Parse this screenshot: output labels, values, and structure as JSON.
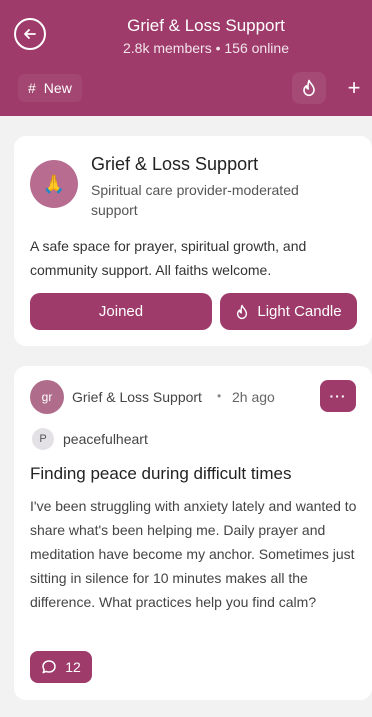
{
  "header": {
    "title": "Grief & Loss Support",
    "subtitle": "2.8k members • 156 online",
    "new_label": "New",
    "new_prefix": "#",
    "plus_label": "+"
  },
  "community": {
    "name": "Grief & Loss Support",
    "description": "Spiritual care provider-moderated support",
    "about": "A safe space for prayer, spiritual growth, and community support. All faiths welcome.",
    "avatar_emoji": "🙏",
    "joined_label": "Joined",
    "candle_label": "Light Candle"
  },
  "post": {
    "avatar_text": "gr",
    "community_name": "Grief & Loss Support",
    "dot": "•",
    "time": "2h ago",
    "more_label": "···",
    "user_initial": "P",
    "username": "peacefulheart",
    "title": "Finding peace during difficult times",
    "body": "I've been struggling with anxiety lately and wanted to share what's been helping me. Daily prayer and meditation have become my anchor. Sometimes just sitting in silence for 10 minutes makes all the difference. What practices help you find calm?",
    "comment_count": "12"
  },
  "colors": {
    "accent": "#9e3b6a",
    "background": "#f3f2f3"
  }
}
